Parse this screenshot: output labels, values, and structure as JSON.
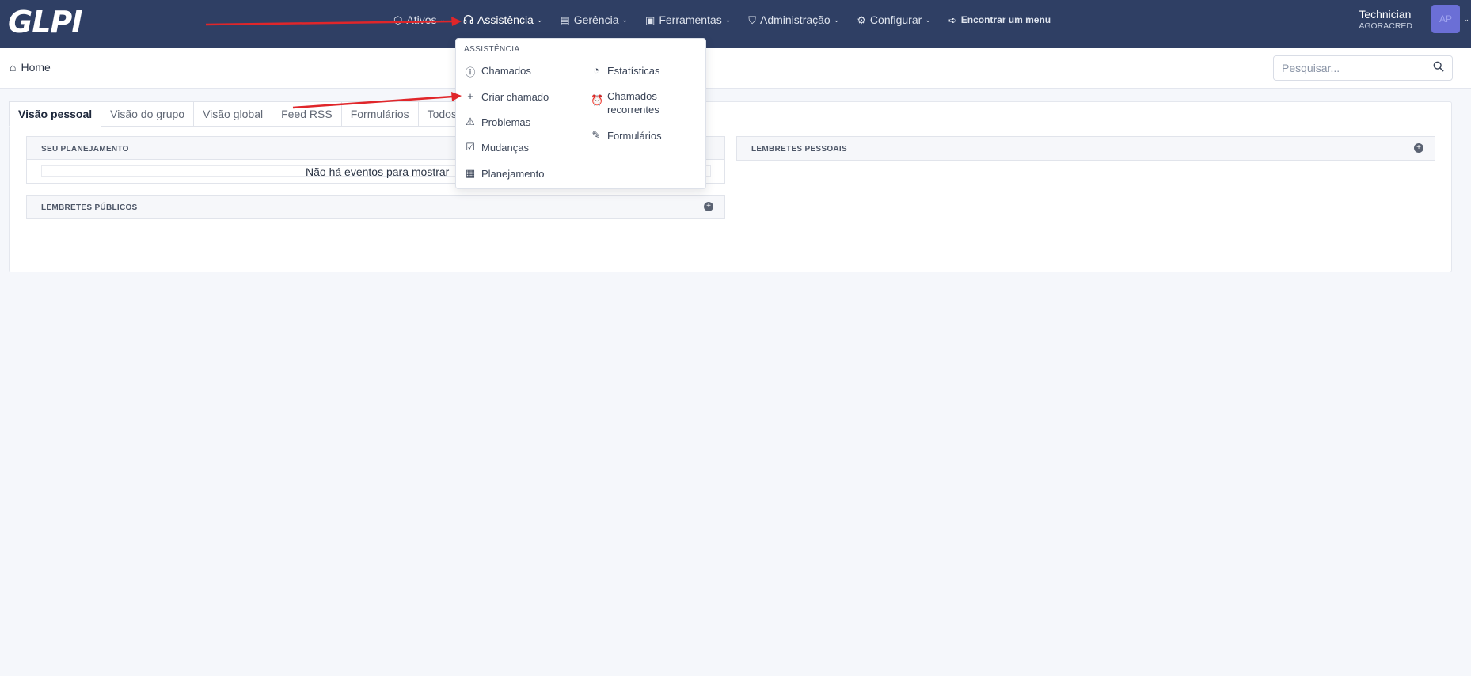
{
  "app": {
    "logo_text": "GLPI"
  },
  "nav": {
    "items": [
      {
        "label": "Ativos",
        "icon": "box-icon"
      },
      {
        "label": "Assistência",
        "icon": "headset-icon"
      },
      {
        "label": "Gerência",
        "icon": "wallet-icon"
      },
      {
        "label": "Ferramentas",
        "icon": "briefcase-icon"
      },
      {
        "label": "Administração",
        "icon": "shield-icon"
      },
      {
        "label": "Configurar",
        "icon": "gear-icon"
      }
    ],
    "find_menu": "Encontrar um menu"
  },
  "user": {
    "name": "Technician",
    "entity": "AGORACRED",
    "initials": "AP"
  },
  "breadcrumb": {
    "home": "Home"
  },
  "search": {
    "placeholder": "Pesquisar..."
  },
  "tabs": [
    "Visão pessoal",
    "Visão do grupo",
    "Visão global",
    "Feed RSS",
    "Formulários",
    "Todos"
  ],
  "panels": {
    "planning": {
      "title": "SEU PLANEJAMENTO",
      "empty": "Não há eventos para mostrar"
    },
    "public_reminders": {
      "title": "LEMBRETES PÚBLICOS"
    },
    "personal_reminders": {
      "title": "LEMBRETES PESSOAIS"
    }
  },
  "dropdown": {
    "header": "ASSISTÊNCIA",
    "left": [
      {
        "label": "Chamados",
        "icon": "alert-circle-icon"
      },
      {
        "label": "Criar chamado",
        "icon": "plus-icon"
      },
      {
        "label": "Problemas",
        "icon": "warning-triangle-icon"
      },
      {
        "label": "Mudanças",
        "icon": "clipboard-check-icon"
      },
      {
        "label": "Planejamento",
        "icon": "calendar-icon"
      }
    ],
    "right": [
      {
        "label": "Estatísticas",
        "icon": "pie-chart-icon"
      },
      {
        "label": "Chamados recorrentes",
        "icon": "alarm-clock-icon"
      },
      {
        "label": "Formulários",
        "icon": "edit-icon"
      }
    ]
  },
  "colors": {
    "topbar": "#2f3f64",
    "annotation_arrow": "#e0262a",
    "avatar": "#6b6fd6"
  }
}
